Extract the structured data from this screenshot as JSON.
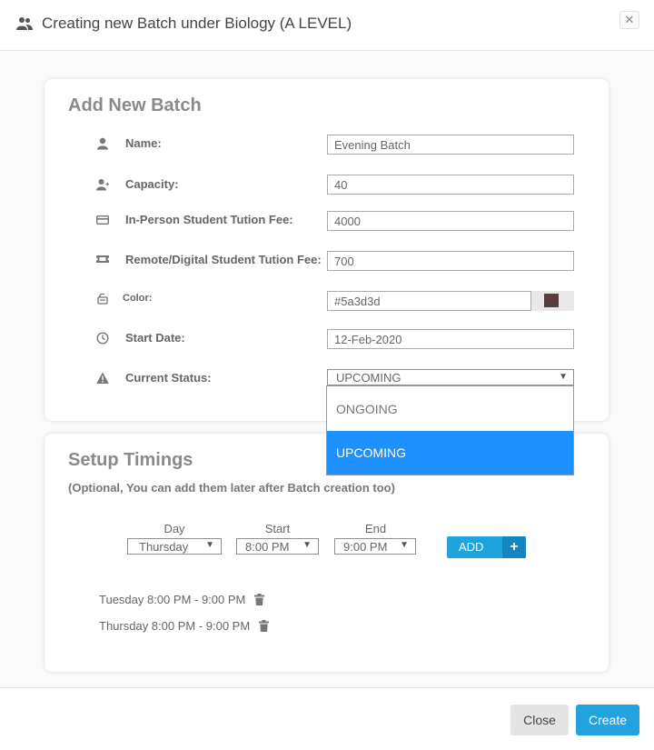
{
  "header": {
    "title": "Creating new Batch under Biology (A LEVEL)",
    "close_symbol": "✕",
    "icon": "users-icon"
  },
  "batch": {
    "card_title": "Add New Batch",
    "rows": {
      "name": {
        "label": "Name:",
        "value": "Evening Batch",
        "icon": "user-icon"
      },
      "capacity": {
        "label": "Capacity:",
        "value": "40",
        "icon": "user-plus-icon"
      },
      "in_person_fee": {
        "label": "In-Person Student Tution Fee:",
        "value": "4000",
        "icon": "credit-card-icon"
      },
      "remote_fee": {
        "label": "Remote/Digital Student Tution Fee:",
        "value": "700",
        "icon": "ticket-icon"
      },
      "color": {
        "label": "Color:",
        "value": "#5a3d3d",
        "icon": "paint-icon",
        "swatch": "#5a3d3d"
      },
      "start_date": {
        "label": "Start Date:",
        "value": "12-Feb-2020",
        "icon": "clock-icon"
      },
      "status": {
        "label": "Current Status:",
        "value": "UPCOMING",
        "icon": "warning-icon"
      }
    },
    "status_options": [
      "ONGOING",
      "UPCOMING"
    ],
    "status_selected": "UPCOMING"
  },
  "timings": {
    "card_title": "Setup Timings",
    "subtitle": "(Optional, You can add them later after Batch creation too)",
    "day_label": "Day",
    "start_label": "Start",
    "end_label": "End",
    "day_value": "Thursday",
    "start_value": "8:00 PM",
    "end_value": "9:00 PM",
    "add_label": "ADD",
    "add_symbol": "+",
    "items": [
      {
        "text": "Tuesday 8:00 PM - 9:00 PM"
      },
      {
        "text": "Thursday 8:00 PM - 9:00 PM"
      }
    ]
  },
  "footer": {
    "close_label": "Close",
    "create_label": "Create"
  },
  "colors": {
    "accent": "#1fa3df",
    "selected_option": "#1e90ff",
    "swatch": "#5a3d3d"
  }
}
